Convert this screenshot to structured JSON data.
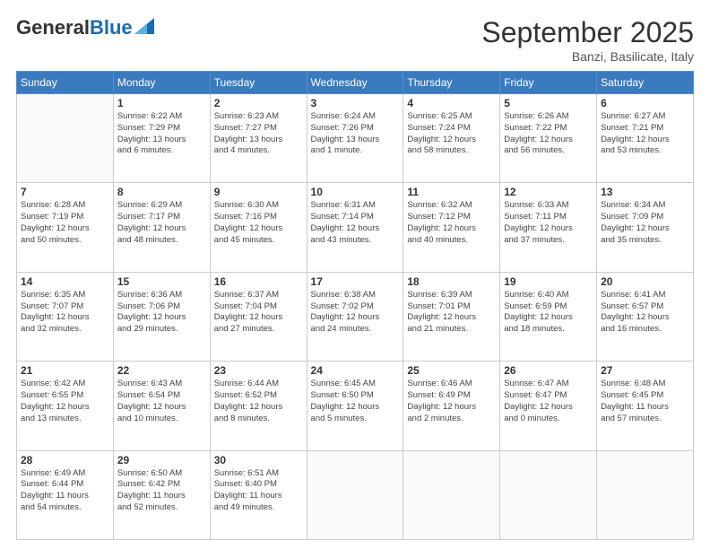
{
  "header": {
    "logo_general": "General",
    "logo_blue": "Blue",
    "month_title": "September 2025",
    "location": "Banzi, Basilicate, Italy"
  },
  "calendar": {
    "days_of_week": [
      "Sunday",
      "Monday",
      "Tuesday",
      "Wednesday",
      "Thursday",
      "Friday",
      "Saturday"
    ],
    "weeks": [
      [
        {
          "day": "",
          "info": ""
        },
        {
          "day": "1",
          "info": "Sunrise: 6:22 AM\nSunset: 7:29 PM\nDaylight: 13 hours\nand 6 minutes."
        },
        {
          "day": "2",
          "info": "Sunrise: 6:23 AM\nSunset: 7:27 PM\nDaylight: 13 hours\nand 4 minutes."
        },
        {
          "day": "3",
          "info": "Sunrise: 6:24 AM\nSunset: 7:26 PM\nDaylight: 13 hours\nand 1 minute."
        },
        {
          "day": "4",
          "info": "Sunrise: 6:25 AM\nSunset: 7:24 PM\nDaylight: 12 hours\nand 58 minutes."
        },
        {
          "day": "5",
          "info": "Sunrise: 6:26 AM\nSunset: 7:22 PM\nDaylight: 12 hours\nand 56 minutes."
        },
        {
          "day": "6",
          "info": "Sunrise: 6:27 AM\nSunset: 7:21 PM\nDaylight: 12 hours\nand 53 minutes."
        }
      ],
      [
        {
          "day": "7",
          "info": "Sunrise: 6:28 AM\nSunset: 7:19 PM\nDaylight: 12 hours\nand 50 minutes."
        },
        {
          "day": "8",
          "info": "Sunrise: 6:29 AM\nSunset: 7:17 PM\nDaylight: 12 hours\nand 48 minutes."
        },
        {
          "day": "9",
          "info": "Sunrise: 6:30 AM\nSunset: 7:16 PM\nDaylight: 12 hours\nand 45 minutes."
        },
        {
          "day": "10",
          "info": "Sunrise: 6:31 AM\nSunset: 7:14 PM\nDaylight: 12 hours\nand 43 minutes."
        },
        {
          "day": "11",
          "info": "Sunrise: 6:32 AM\nSunset: 7:12 PM\nDaylight: 12 hours\nand 40 minutes."
        },
        {
          "day": "12",
          "info": "Sunrise: 6:33 AM\nSunset: 7:11 PM\nDaylight: 12 hours\nand 37 minutes."
        },
        {
          "day": "13",
          "info": "Sunrise: 6:34 AM\nSunset: 7:09 PM\nDaylight: 12 hours\nand 35 minutes."
        }
      ],
      [
        {
          "day": "14",
          "info": "Sunrise: 6:35 AM\nSunset: 7:07 PM\nDaylight: 12 hours\nand 32 minutes."
        },
        {
          "day": "15",
          "info": "Sunrise: 6:36 AM\nSunset: 7:06 PM\nDaylight: 12 hours\nand 29 minutes."
        },
        {
          "day": "16",
          "info": "Sunrise: 6:37 AM\nSunset: 7:04 PM\nDaylight: 12 hours\nand 27 minutes."
        },
        {
          "day": "17",
          "info": "Sunrise: 6:38 AM\nSunset: 7:02 PM\nDaylight: 12 hours\nand 24 minutes."
        },
        {
          "day": "18",
          "info": "Sunrise: 6:39 AM\nSunset: 7:01 PM\nDaylight: 12 hours\nand 21 minutes."
        },
        {
          "day": "19",
          "info": "Sunrise: 6:40 AM\nSunset: 6:59 PM\nDaylight: 12 hours\nand 18 minutes."
        },
        {
          "day": "20",
          "info": "Sunrise: 6:41 AM\nSunset: 6:57 PM\nDaylight: 12 hours\nand 16 minutes."
        }
      ],
      [
        {
          "day": "21",
          "info": "Sunrise: 6:42 AM\nSunset: 6:55 PM\nDaylight: 12 hours\nand 13 minutes."
        },
        {
          "day": "22",
          "info": "Sunrise: 6:43 AM\nSunset: 6:54 PM\nDaylight: 12 hours\nand 10 minutes."
        },
        {
          "day": "23",
          "info": "Sunrise: 6:44 AM\nSunset: 6:52 PM\nDaylight: 12 hours\nand 8 minutes."
        },
        {
          "day": "24",
          "info": "Sunrise: 6:45 AM\nSunset: 6:50 PM\nDaylight: 12 hours\nand 5 minutes."
        },
        {
          "day": "25",
          "info": "Sunrise: 6:46 AM\nSunset: 6:49 PM\nDaylight: 12 hours\nand 2 minutes."
        },
        {
          "day": "26",
          "info": "Sunrise: 6:47 AM\nSunset: 6:47 PM\nDaylight: 12 hours\nand 0 minutes."
        },
        {
          "day": "27",
          "info": "Sunrise: 6:48 AM\nSunset: 6:45 PM\nDaylight: 11 hours\nand 57 minutes."
        }
      ],
      [
        {
          "day": "28",
          "info": "Sunrise: 6:49 AM\nSunset: 6:44 PM\nDaylight: 11 hours\nand 54 minutes."
        },
        {
          "day": "29",
          "info": "Sunrise: 6:50 AM\nSunset: 6:42 PM\nDaylight: 11 hours\nand 52 minutes."
        },
        {
          "day": "30",
          "info": "Sunrise: 6:51 AM\nSunset: 6:40 PM\nDaylight: 11 hours\nand 49 minutes."
        },
        {
          "day": "",
          "info": ""
        },
        {
          "day": "",
          "info": ""
        },
        {
          "day": "",
          "info": ""
        },
        {
          "day": "",
          "info": ""
        }
      ]
    ]
  }
}
